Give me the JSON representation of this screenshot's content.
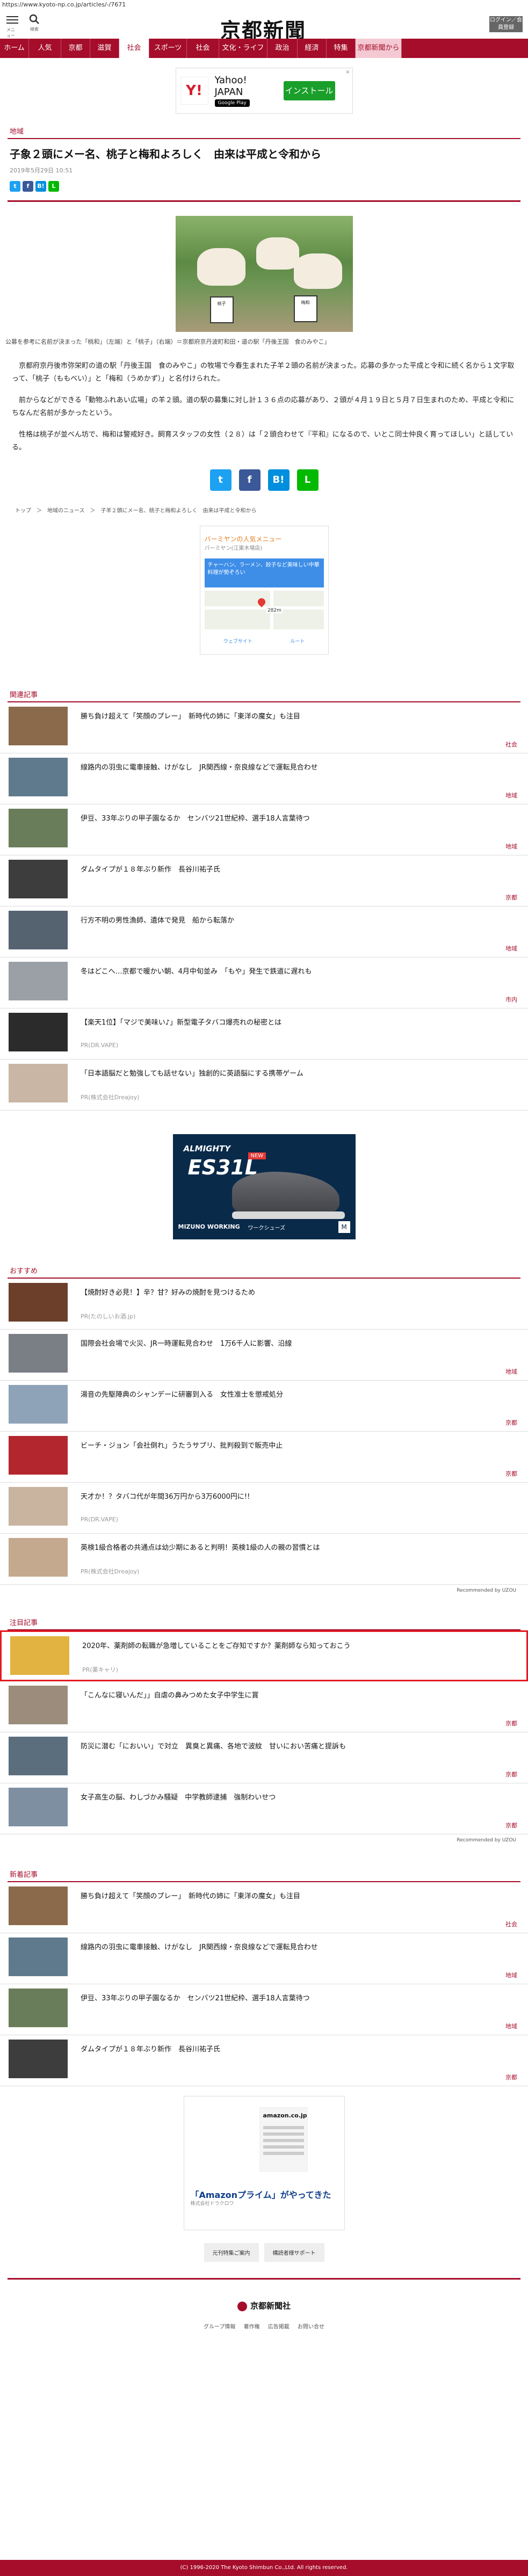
{
  "url": "https://www.kyoto-np.co.jp/articles/-/7671",
  "header": {
    "menu_label": "メニュー",
    "search_label": "検索",
    "logo_text": "京都新聞",
    "login_label": "ログイン／会員登録"
  },
  "nav": [
    "ホーム",
    "人気",
    "京都",
    "滋賀",
    "社会",
    "スポーツ",
    "社会",
    "文化・ライフ",
    "政治",
    "経済",
    "特集",
    "京都新聞から"
  ],
  "nav_active_index": 4,
  "top_ad": {
    "brand_line1": "Yahoo!",
    "brand_line2": "JAPAN",
    "store": "Google Play",
    "install": "インストール",
    "close": "×"
  },
  "article": {
    "section": "地域",
    "title": "子象２頭にメー名、桃子と梅和よろしく　由来は平成と令和から",
    "date": "2019年5月29日 10:51",
    "share_mini": [
      "t",
      "f",
      "B!",
      "L"
    ],
    "photo_signs": [
      "桃子",
      "梅和"
    ],
    "caption": "公募を参考に名前が決まった「桃和」（左端）と「桃子」（右端）＝京都府京丹波町和田・道の駅「丹後王国　食のみやこ」",
    "paragraphs": [
      "京都府京丹後市弥栄町の道の駅「丹後王国　食のみやこ」の牧場で今春生まれた子羊２頭の名前が決まった。応募の多かった平成と令和に続く名から１文字取って、「桃子（ももべい）」と「梅和（うめかず）」と名付けられた。",
      "前からなどができる「動物ふれあい広場」の羊２頭。道の駅の募集に対し計１３６点の応募があり、２頭が４月１９日と５月７日生まれのため、平成と令和にちなんだ名前が多かったという。",
      "性格は桃子が並べん坊で、梅和は警戒好き。飼育スタッフの女性（２８）は「２頭合わせて『平和』になるので、いとこ同士仲良く育ってほしい」と話している。"
    ],
    "share_big": [
      "t",
      "f",
      "B!",
      "L"
    ],
    "breadcrumbs": "トップ　＞　地域のニュース　＞　子羊２頭にメー名、桃子と梅和よろしく　由来は平成と令和から"
  },
  "map_ad": {
    "title": "バーミヤンの人気メニュー",
    "sub": "バーミヤン(江東木場店)",
    "blue_text": "チャーハン、ラーメン、餃子など美味しい中華料理が勢ぞろい",
    "distance": "282m",
    "link1": "ウェブサイト",
    "link2": "ルート"
  },
  "related": {
    "head": "関連記事",
    "items": [
      {
        "title": "勝ち負け超えて「笑顔のプレー」　新時代の姉に「東洋の魔女」も注目",
        "cat": "社会"
      },
      {
        "title": "線路内の羽虫に電車接触、けがなし　JR関西線・奈良線などで運転見合わせ",
        "cat": "地域"
      },
      {
        "title": "伊豆、33年ぶりの甲子園なるか　センバツ21世紀枠、選手18人言葉待つ",
        "cat": "地域"
      },
      {
        "title": "ダムタイプが１８年ぶり新作　長谷川祐子氏",
        "cat": "京都"
      },
      {
        "title": "行方不明の男性漁師、遺体で発見　船から転落か",
        "cat": "地域"
      },
      {
        "title": "冬はどこへ…京都で暖かい朝、4月中旬並み　「もや」発生で鉄道に遅れも",
        "cat": "市内"
      },
      {
        "title": "【楽天1位】「マジで美味い♪」新型電子タバコ爆売れの秘密とは",
        "sponsor": "PR(DR.VAPE)"
      },
      {
        "title": "「日本語脳だと勉強しても話せない」独創的に英語脳にする携帯ゲーム",
        "sponsor": "PR(株式会社Dreajoy)"
      }
    ]
  },
  "shoe_ad": {
    "brand": "ALMIGHTY",
    "new": "NEW",
    "model": "ES31L",
    "maker": "MIZUNO WORKING",
    "type": "ワークシューズ",
    "logo": "M"
  },
  "recommend": {
    "head": "おすすめ",
    "items": [
      {
        "title": "【焼酎好き必見！】辛？甘？好みの焼酎を見つけるため",
        "sponsor": "PR(たのしいお酒.jp)"
      },
      {
        "title": "国際会社会場で火災、JR一時運転見合わせ　1万6千人に影響、沿線",
        "cat": "地域"
      },
      {
        "title": "湯音の先駆陣典のシャンデーに研審到入る　女性准士を懲戒処分",
        "cat": "京都"
      },
      {
        "title": "ビーチ・ジョン「会社倒れ」うたうサプリ、批判殺到で販売中止",
        "cat": "京都"
      },
      {
        "title": "天才か！？タバコ代が年間36万円から3万6000円に!!",
        "sponsor": "PR(DR.VAPE)"
      },
      {
        "title": "英検1級合格者の共通点は幼少期にあると判明！英検1級の人の親の習慣とは",
        "sponsor": "PR(株式会社Dreajoy)"
      }
    ],
    "powered": "Recommended by UZOU"
  },
  "attention": {
    "head": "注目記事",
    "items": [
      {
        "title": "2020年、薬剤師の転職が急増していることをご存知ですか？薬剤師なら知っておこう",
        "sponsor": "PR(薬キャリ)"
      },
      {
        "title": "「こんなに寝いんだ」」自虐の鼻みつめた女子中学生に賞",
        "cat": "京都"
      },
      {
        "title": "防災に潜む「においい」で対立　異臭と異痛、各地で波紋　甘いにおい苦痛と提訴も",
        "cat": "京都"
      },
      {
        "title": "女子高生の脳、わしづかみ騒疑　中学教師逮捕　強制わいせつ",
        "cat": "京都"
      }
    ],
    "powered": "Recommended by UZOU"
  },
  "newarr": {
    "head": "新着記事",
    "items": [
      {
        "title": "勝ち負け超えて「笑顔のプレー」　新時代の姉に「東洋の魔女」も注目",
        "cat": "社会"
      },
      {
        "title": "線路内の羽虫に電車接触、けがなし　JR関西線・奈良線などで運転見合わせ",
        "cat": "地域"
      },
      {
        "title": "伊豆、33年ぶりの甲子園なるか　センバツ21世紀枠、選手18人言葉待つ",
        "cat": "地域"
      },
      {
        "title": "ダムタイプが１８年ぶり新作　長谷川祐子氏",
        "cat": "京都"
      }
    ]
  },
  "amazon_ad": {
    "logo": "amazon.co.jp",
    "prime": "「Amazonプライム」がやってきた",
    "small": "株式会社ドラクロワ"
  },
  "buttons": [
    "元刊特集ご案内",
    "構読者様サポート"
  ],
  "footer": {
    "logo": "京都新聞社",
    "links": [
      "グループ情報",
      "著作権",
      "広告掲載",
      "お問い合せ"
    ],
    "copyright": "(C) 1996-2020 The Kyoto Shimbun Co.,Ltd. All rights reserved."
  }
}
